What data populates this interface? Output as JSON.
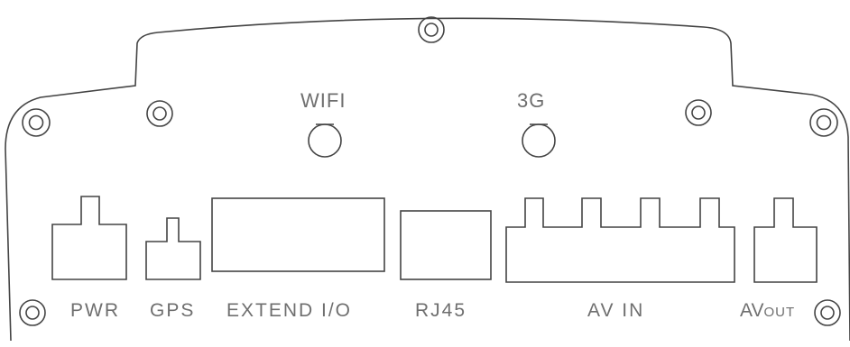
{
  "labels": {
    "wifi": "WIFI",
    "g3": "3G",
    "pwr": "PWR",
    "gps": "GPS",
    "extend_io": "EXTEND I/O",
    "rj45": "RJ45",
    "av_in": "AV IN",
    "av_out_main": "AV",
    "av_out_small": "OUT"
  },
  "colors": {
    "line": "#444444",
    "text": "#6f6f6f",
    "background": "#ffffff"
  }
}
